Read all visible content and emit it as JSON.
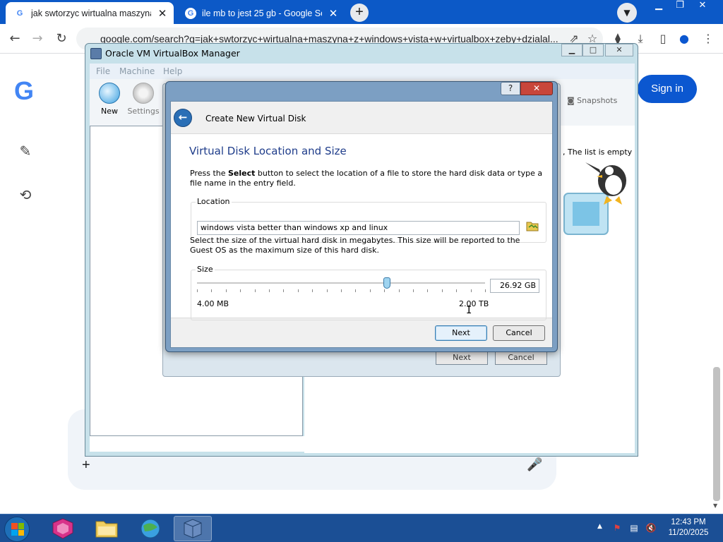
{
  "browser": {
    "tabs": [
      {
        "title": "jak swtorzyc wirtualna maszyna",
        "active": true
      },
      {
        "title": "ile mb to jest 25 gb - Google Se",
        "active": false
      }
    ],
    "new_tab_label": "+",
    "close_label": "✕",
    "url": "google.com/search?q=jak+swtorzyc+wirtualna+maszyna+z+windows+vista+w+virtualbox+zeby+dzialal..."
  },
  "google": {
    "logo": "G",
    "sign_in_label": "Sign in",
    "plus_label": "+"
  },
  "vbox_manager": {
    "title": "Oracle VM VirtualBox Manager",
    "menu": [
      "File",
      "Machine",
      "Help"
    ],
    "toolbar": {
      "new": "New",
      "settings": "Settings",
      "snapshots": "Snapshots"
    },
    "empty_text": ", The list is empty"
  },
  "background_wizard": {
    "next": "Next",
    "cancel": "Cancel"
  },
  "wizard": {
    "caption": "Create New Virtual Disk",
    "help_label": "?",
    "close_label": "✕",
    "heading": "Virtual Disk Location and Size",
    "intro_pre": "Press the ",
    "intro_bold": "Select",
    "intro_post": " button to select the location of a file to store the hard disk data or type a file name in the entry field.",
    "location_label": "Location",
    "location_value": "windows vista better than windows xp and linux",
    "size_text": "Select the size of the virtual hard disk in megabytes. This size will be reported to the Guest OS as the maximum size of this hard disk.",
    "size_label": "Size",
    "size_value": "26.92 GB",
    "size_min": "4.00 MB",
    "size_max": "2.00 TB",
    "slider_position": 0.66,
    "next_label": "Next",
    "cancel_label": "Cancel"
  },
  "taskbar": {
    "time": "12:43 PM",
    "date": "11/20/2025"
  },
  "colors": {
    "chrome_frame": "#0c59c7",
    "google_blue": "#0b57d0",
    "taskbar": "#1b4f95",
    "wizard_heading": "#1e3c8a"
  }
}
